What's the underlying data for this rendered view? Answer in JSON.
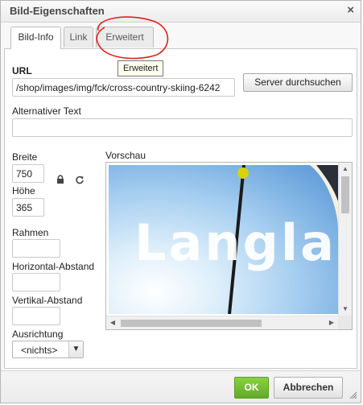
{
  "dialog": {
    "title": "Bild-Eigenschaften",
    "close_glyph": "×"
  },
  "tabs": [
    {
      "label": "Bild-Info",
      "active": true
    },
    {
      "label": "Link",
      "active": false
    },
    {
      "label": "Erweitert",
      "active": false
    }
  ],
  "tooltip": "Erweitert",
  "form": {
    "url_label": "URL",
    "url_value": "/shop/images/img/fck/cross-country-skiing-6242",
    "server_button": "Server durchsuchen",
    "alt_label": "Alternativer Text",
    "alt_value": "",
    "width_label": "Breite",
    "width_value": "750",
    "height_label": "Höhe",
    "height_value": "365",
    "border_label": "Rahmen",
    "border_value": "",
    "hspace_label": "Horizontal-Abstand",
    "hspace_value": "",
    "vspace_label": "Vertikal-Abstand",
    "vspace_value": "",
    "align_label": "Ausrichtung",
    "align_value": "<nichts>"
  },
  "preview": {
    "label": "Vorschau",
    "image_text": "Langlauf"
  },
  "footer": {
    "ok_label": "OK",
    "cancel_label": "Abbrechen"
  },
  "colors": {
    "ok_button": "#6fb92f",
    "annotation_circle": "#e0201b"
  },
  "icons": {
    "lock": "lock-icon",
    "reset": "reset-size-icon",
    "close": "close-icon",
    "resize": "resize-grip-icon"
  }
}
